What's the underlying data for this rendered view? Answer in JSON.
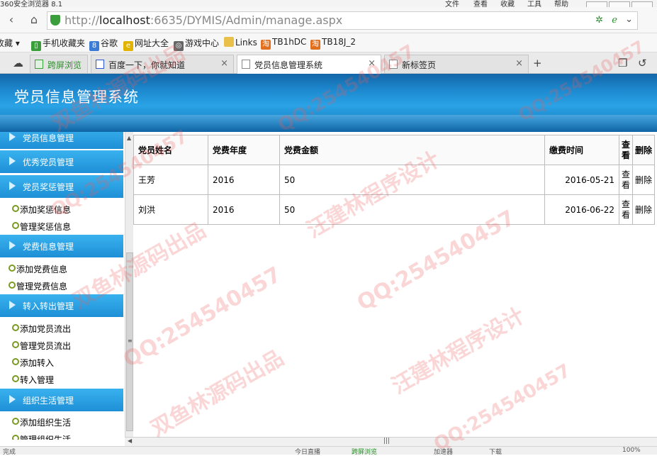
{
  "window": {
    "title": "360安全浏览器 8.1",
    "menus": [
      "文件",
      "查看",
      "收藏",
      "工具",
      "帮助"
    ]
  },
  "address": {
    "url_prefix": "http://",
    "url_host": "localhost",
    "url_rest": ":6635/DYMIS/Admin/manage.aspx"
  },
  "bookmarks": [
    "收藏",
    "手机收藏夹",
    "谷歌",
    "网址大全",
    "游戏中心",
    "Links",
    "TB1hDC",
    "TB18J_2"
  ],
  "tabs": [
    {
      "label": "跨屏浏览"
    },
    {
      "label": "百度一下，你就知道"
    },
    {
      "label": "党员信息管理系统"
    },
    {
      "label": "新标签页"
    }
  ],
  "banner": {
    "title": "党员信息管理系统"
  },
  "sidebar": {
    "groups": [
      {
        "label": "党员信息管理",
        "items": []
      },
      {
        "label": "优秀党员管理",
        "items": []
      },
      {
        "label": "党员奖惩管理",
        "items": [
          "添加奖惩信息",
          "管理奖惩信息"
        ]
      },
      {
        "label": "党费信息管理",
        "items": [
          "添加党费信息",
          "管理党费信息"
        ]
      },
      {
        "label": "转入转出管理",
        "items": [
          "添加党员流出",
          "管理党员流出",
          "添加转入",
          "转入管理"
        ]
      },
      {
        "label": "组织生活管理",
        "items": [
          "添加组织生活",
          "管理组织生活"
        ]
      }
    ]
  },
  "table": {
    "headers": [
      "党员姓名",
      "党费年度",
      "党费金额",
      "缴费时间",
      "查看",
      "删除"
    ],
    "rows": [
      {
        "name": "王芳",
        "year": "2016",
        "amount": "50",
        "date": "2016-05-21",
        "view": "查看",
        "delete": "删除"
      },
      {
        "name": "刘洪",
        "year": "2016",
        "amount": "50",
        "date": "2016-06-22",
        "view": "查看",
        "delete": "删除"
      }
    ]
  },
  "statusbar": {
    "left": "完成",
    "items": [
      "今日直播",
      "跨屏浏览",
      "加速器",
      "下载"
    ],
    "zoom": "100%"
  },
  "watermarks": [
    "双鱼林源码出品",
    "QQ:254540457",
    "汪建林程序设计"
  ],
  "colors": {
    "banner": "#1e8bd1",
    "nav_group": "#2aa3e6",
    "bullet": "#7a9a24"
  }
}
